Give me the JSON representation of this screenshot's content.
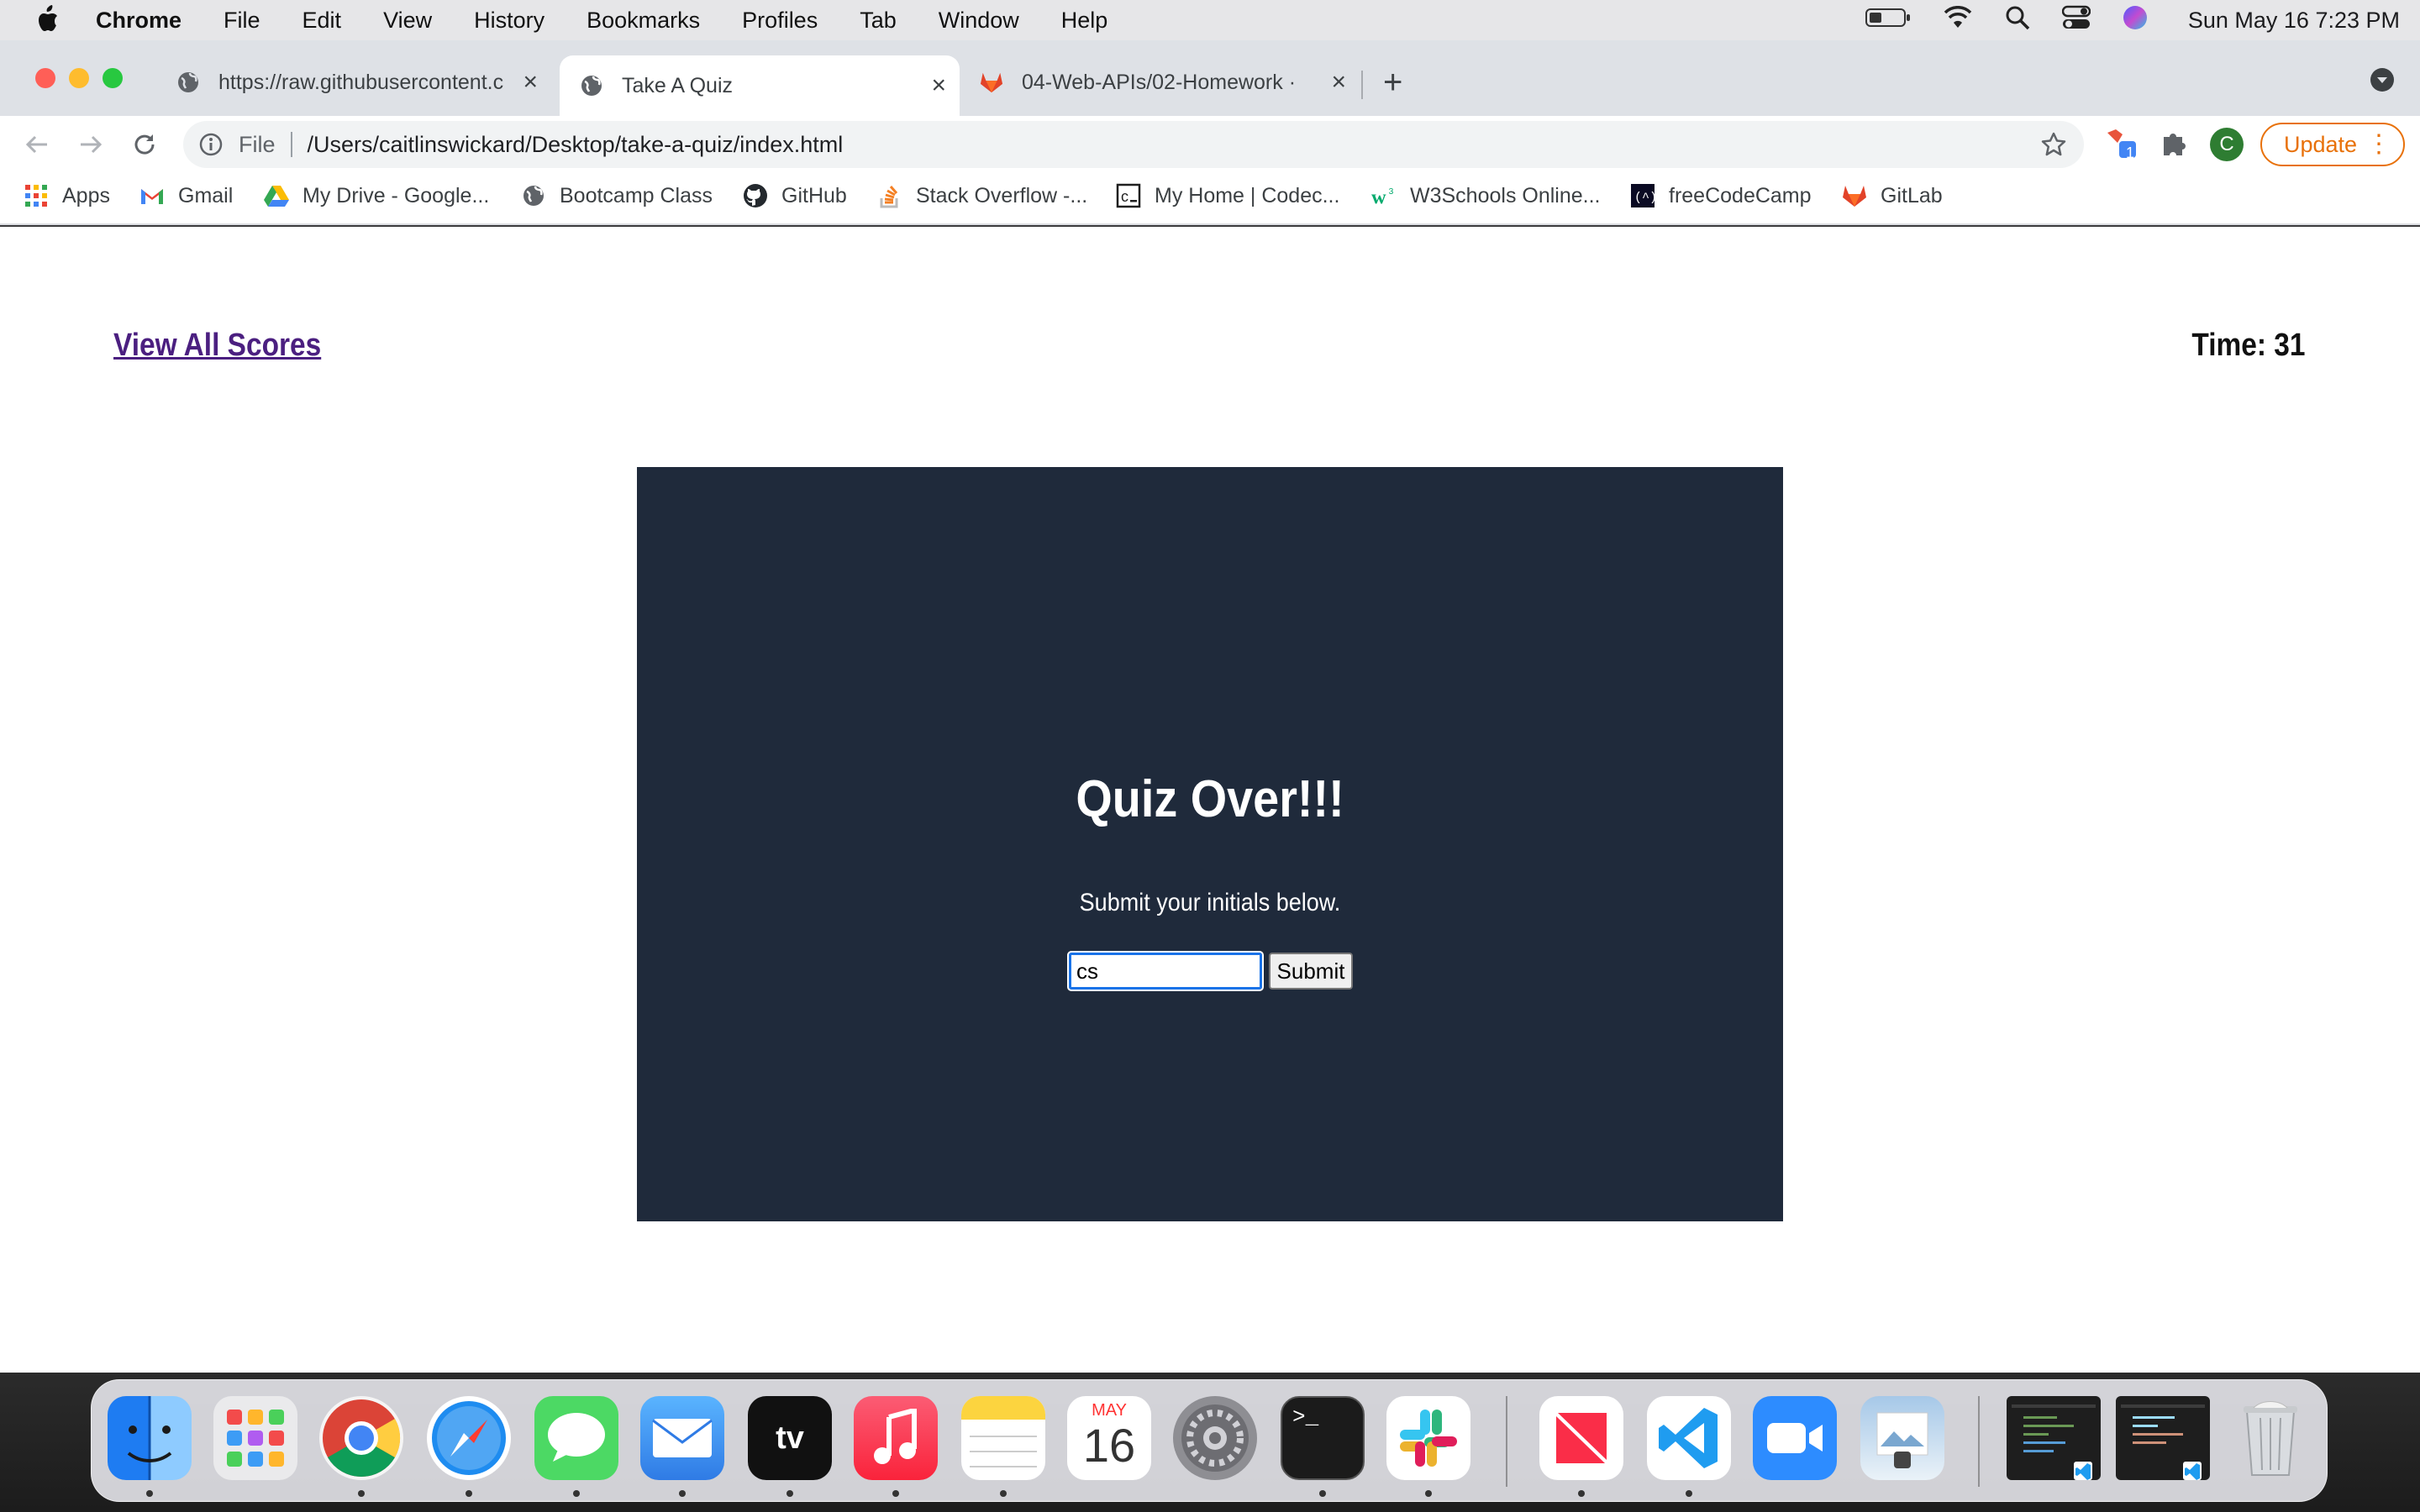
{
  "menubar": {
    "app_name": "Chrome",
    "menus": [
      "File",
      "Edit",
      "View",
      "History",
      "Bookmarks",
      "Profiles",
      "Tab",
      "Window",
      "Help"
    ],
    "clock": "Sun May 16  7:23 PM"
  },
  "tabs": [
    {
      "title": "https://raw.githubusercontent.c",
      "icon": "globe-icon",
      "active": false
    },
    {
      "title": "Take A Quiz",
      "icon": "globe-icon",
      "active": true
    },
    {
      "title": "04-Web-APIs/02-Homework · ",
      "icon": "gitlab-icon",
      "active": false
    }
  ],
  "address_bar": {
    "scheme": "File",
    "url": "/Users/caitlinswickard/Desktop/take-a-quiz/index.html"
  },
  "profile_initial": "C",
  "extension_badge": "1",
  "update_label": "Update",
  "bookmarks": [
    {
      "label": "Apps",
      "icon": "apps-grid-icon"
    },
    {
      "label": "Gmail",
      "icon": "gmail-icon"
    },
    {
      "label": "My Drive - Google...",
      "icon": "google-drive-icon"
    },
    {
      "label": "Bootcamp Class",
      "icon": "globe-icon"
    },
    {
      "label": "GitHub",
      "icon": "github-icon"
    },
    {
      "label": "Stack Overflow -...",
      "icon": "stackoverflow-icon"
    },
    {
      "label": "My Home | Codec...",
      "icon": "codecademy-icon"
    },
    {
      "label": "W3Schools Online...",
      "icon": "w3schools-icon"
    },
    {
      "label": "freeCodeCamp",
      "icon": "freecodecamp-icon"
    },
    {
      "label": "GitLab",
      "icon": "gitlab-icon"
    }
  ],
  "page": {
    "view_scores_link": "View All Scores",
    "timer": "Time: 31",
    "quiz_title": "Quiz Over!!!",
    "quiz_subtitle": "Submit your initials below.",
    "initials_value": "cs",
    "submit_label": "Submit"
  },
  "dock_month": "MAY",
  "dock_day": "16",
  "colors": {
    "quiz_box": "#1f2a3b",
    "link": "#4b1f80",
    "accent": "#1a73e8",
    "update": "#e8710a"
  }
}
